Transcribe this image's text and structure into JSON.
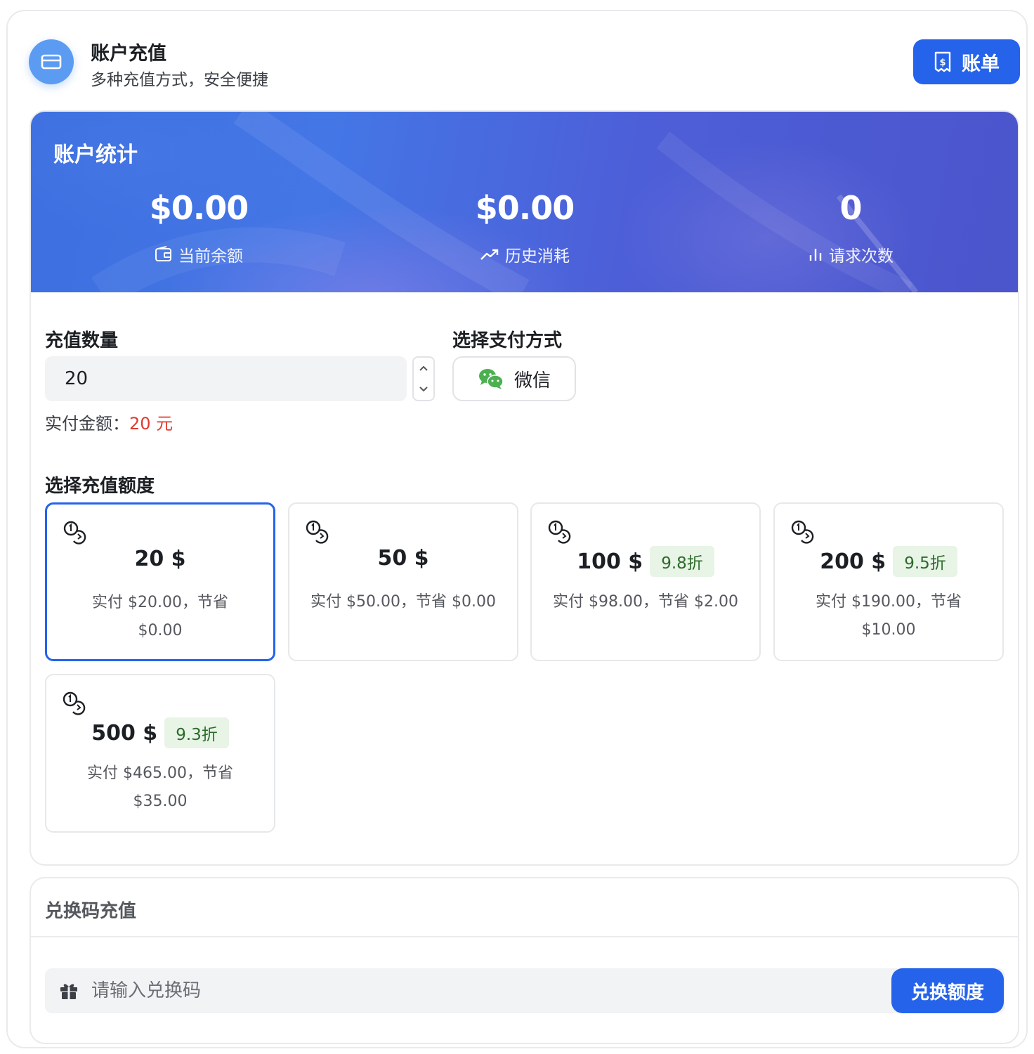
{
  "header": {
    "title": "账户充值",
    "subtitle": "多种充值方式，安全便捷",
    "bill_button": "账单"
  },
  "stats": {
    "title": "账户统计",
    "items": [
      {
        "value": "$0.00",
        "label": "当前余额",
        "icon": "wallet-icon"
      },
      {
        "value": "$0.00",
        "label": "历史消耗",
        "icon": "trend-up-icon"
      },
      {
        "value": "0",
        "label": "请求次数",
        "icon": "bar-chart-icon"
      }
    ]
  },
  "recharge": {
    "quantity_label": "充值数量",
    "quantity_value": "20",
    "payment_label": "选择支付方式",
    "payment_method": "微信",
    "actual_prefix": "实付金额：",
    "actual_amount": "20 元",
    "tier_label": "选择充值额度",
    "tiers": [
      {
        "amount": "20 $",
        "badge": "",
        "desc": "实付 $20.00，节省 $0.00",
        "selected": true
      },
      {
        "amount": "50 $",
        "badge": "",
        "desc": "实付 $50.00，节省 $0.00",
        "selected": false
      },
      {
        "amount": "100 $",
        "badge": "9.8折",
        "desc": "实付 $98.00，节省 $2.00",
        "selected": false
      },
      {
        "amount": "200 $",
        "badge": "9.5折",
        "desc": "实付 $190.00，节省 $10.00",
        "selected": false
      },
      {
        "amount": "500 $",
        "badge": "9.3折",
        "desc": "实付 $465.00，节省 $35.00",
        "selected": false
      }
    ]
  },
  "redeem": {
    "title": "兑换码充值",
    "placeholder": "请输入兑换码",
    "button": "兑换额度"
  },
  "colors": {
    "accent": "#2563eb",
    "price_red": "#e03a2f",
    "badge_green": "#2d6a2a",
    "wechat_green": "#4caf50"
  }
}
